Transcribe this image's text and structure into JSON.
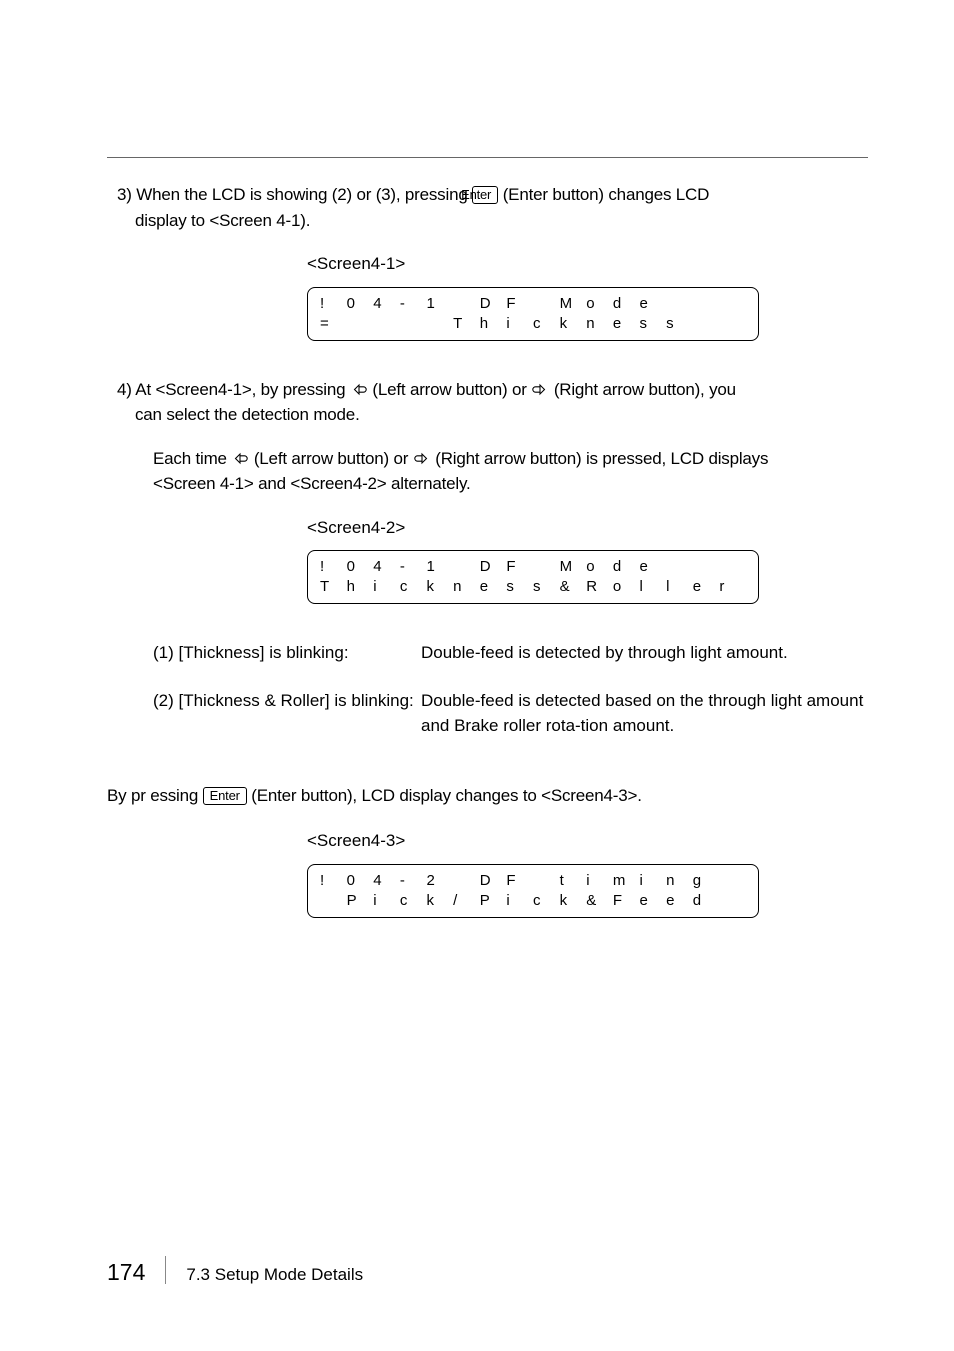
{
  "step3": {
    "line1_prefix": "3) When the LCD is showing (2) or (3), pressing ",
    "enter_label": "Enter",
    "line1_suffix": " (Enter button) changes LCD",
    "line2": "display to <Screen 4-1).",
    "screen_label": "<Screen4-1>",
    "lcd_row1": [
      "!",
      "0",
      "4",
      "-",
      "1",
      "",
      "D",
      "F",
      "",
      "M",
      "o",
      "d",
      "e",
      "",
      "",
      ""
    ],
    "lcd_row2": [
      "=",
      "",
      "",
      "",
      "",
      "T",
      "h",
      "i",
      "c",
      "k",
      "n",
      "e",
      "s",
      "s",
      "",
      ""
    ]
  },
  "step4": {
    "line1_prefix": "4) At <Screen4-1>, by pressing ",
    "left_suffix": " (Left arrow button) or ",
    "right_suffix": " (Right arrow button), you",
    "line2": "can select the detection mode.",
    "body_prefix": "Each time ",
    "body_mid": " (Left arrow button) or ",
    "body_suffix": " (Right arrow button) is pressed, LCD displays",
    "body_line2": "<Screen 4-1> and <Screen4-2> alternately.",
    "screen_label": "<Screen4-2>",
    "lcd_row1": [
      "!",
      "0",
      "4",
      "-",
      "1",
      "",
      "D",
      "F",
      "",
      "M",
      "o",
      "d",
      "e",
      "",
      "",
      ""
    ],
    "lcd_row2": [
      "T",
      "h",
      "i",
      "c",
      "k",
      "n",
      "e",
      "s",
      "s",
      "&",
      "R",
      "o",
      "l",
      "l",
      "e",
      "r"
    ]
  },
  "defs": {
    "d1_left": "(1) [Thickness] is blinking:",
    "d1_right": "Double-feed is detected by through light amount.",
    "d2_left": "(2) [Thickness & Roller] is blinking:",
    "d2_right": "Double-feed is detected based on the through light amount and Brake roller rota-tion amount."
  },
  "closing": {
    "prefix": "By pr essing ",
    "enter_label": "Enter",
    "suffix": " (Enter button), LCD display changes to <Screen4-3>.",
    "screen_label": "<Screen4-3>",
    "lcd_row1": [
      "!",
      "0",
      "4",
      "-",
      "2",
      "",
      "D",
      "F",
      "",
      "t",
      "i",
      "m",
      "i",
      "n",
      "g",
      ""
    ],
    "lcd_row2": [
      "",
      "P",
      "i",
      "c",
      "k",
      "/",
      "P",
      "i",
      "c",
      "k",
      "&",
      "F",
      "e",
      "e",
      "d",
      ""
    ]
  },
  "footer": {
    "page": "174",
    "section": "7.3  Setup Mode Details"
  }
}
